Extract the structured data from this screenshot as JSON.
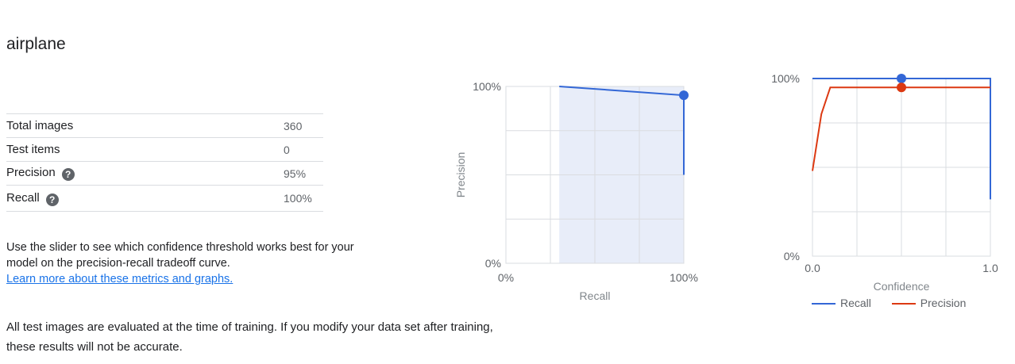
{
  "page": {
    "title": "airplane",
    "stats": [
      {
        "label": "Total images",
        "value": "360",
        "help": false
      },
      {
        "label": "Test items",
        "value": "0",
        "help": false
      },
      {
        "label": "Precision",
        "value": "95%",
        "help": true
      },
      {
        "label": "Recall",
        "value": "100%",
        "help": true
      }
    ],
    "help_glyph": "?",
    "description": "Use the slider to see which confidence threshold works best for your model on the precision-recall tradeoff curve.",
    "learn_more": "Learn more about these metrics and graphs.",
    "note": "All test images are evaluated at the time of training. If you modify your data set after training, these results will not be accurate."
  },
  "colors": {
    "recall": "#3367d6",
    "precision": "#dc3912",
    "grid": "#dadce0",
    "fill": "#e8edf9"
  },
  "chart_data": [
    {
      "type": "line",
      "xlabel": "Recall",
      "ylabel": "Precision",
      "xlim": [
        0,
        1
      ],
      "ylim": [
        0,
        1
      ],
      "x_tick_labels": [
        "0%",
        "100%"
      ],
      "y_tick_labels": [
        "0%",
        "100%"
      ],
      "grid": true,
      "shaded_recall_range": [
        0.3,
        1.0
      ],
      "series": [
        {
          "x": [
            0.3,
            1.0,
            1.0
          ],
          "y": [
            1.0,
            0.95,
            0.5
          ]
        }
      ],
      "selected_point": {
        "x": 1.0,
        "y": 0.95
      }
    },
    {
      "type": "line",
      "xlabel": "Confidence",
      "xlim": [
        0,
        1
      ],
      "ylim": [
        0,
        1
      ],
      "x_tick_labels": [
        "0.0",
        "1.0"
      ],
      "y_tick_labels": [
        "0%",
        "100%"
      ],
      "grid": true,
      "legend_position": "bottom",
      "series": [
        {
          "name": "Recall",
          "x": [
            0,
            1.0,
            1.0
          ],
          "y": [
            1.0,
            1.0,
            0.32
          ]
        },
        {
          "name": "Precision",
          "x": [
            0,
            0,
            0.05,
            0.1,
            1.0
          ],
          "y": [
            0.48,
            0.48,
            0.8,
            0.95,
            0.95
          ]
        }
      ],
      "threshold": 0.5,
      "threshold_values": {
        "recall": 1.0,
        "precision": 0.95
      }
    }
  ]
}
